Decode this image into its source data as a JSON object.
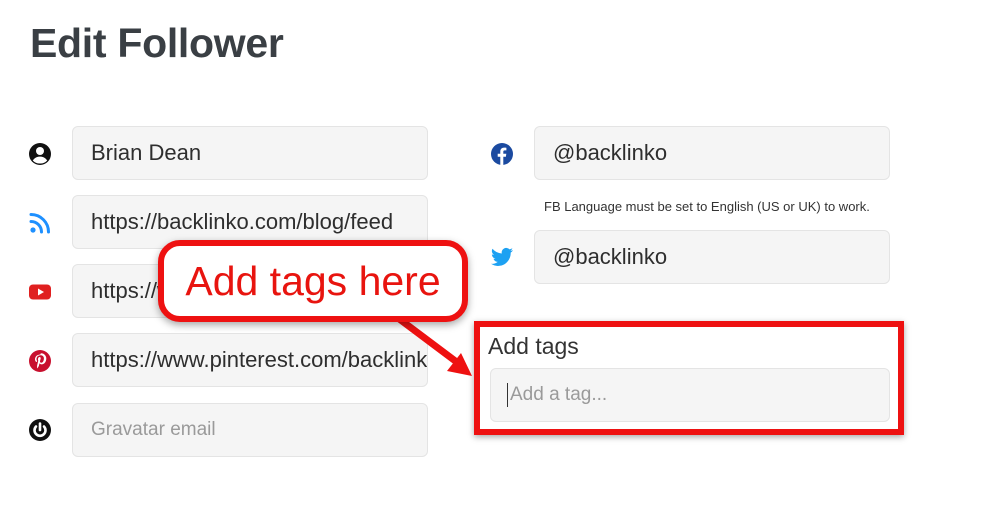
{
  "page": {
    "title": "Edit Follower"
  },
  "left_fields": [
    {
      "icon": "user-circle-icon",
      "value": "Brian Dean"
    },
    {
      "icon": "rss-icon",
      "value": "https://backlinko.com/blog/feed"
    },
    {
      "icon": "youtube-icon",
      "value": "https://www.youtube.com/c/backlinko"
    },
    {
      "icon": "pinterest-icon",
      "value": "https://www.pinterest.com/backlinko"
    },
    {
      "icon": "gravatar-icon",
      "placeholder": "Gravatar email"
    }
  ],
  "right_fields": {
    "facebook": {
      "icon": "facebook-icon",
      "value": "@backlinko",
      "note": "FB Language must be set to English (US or UK) to work."
    },
    "twitter": {
      "icon": "twitter-icon",
      "value": "@backlinko"
    }
  },
  "tags": {
    "label": "Add tags",
    "placeholder": "Add a tag..."
  },
  "annotation": {
    "callout_text": "Add tags here"
  },
  "colors": {
    "highlight": "#ee1111",
    "rss": "#1e90ff",
    "youtube": "#e02020",
    "pinterest": "#c8102e",
    "facebook": "#1b4aa0",
    "twitter": "#1da1f2"
  }
}
